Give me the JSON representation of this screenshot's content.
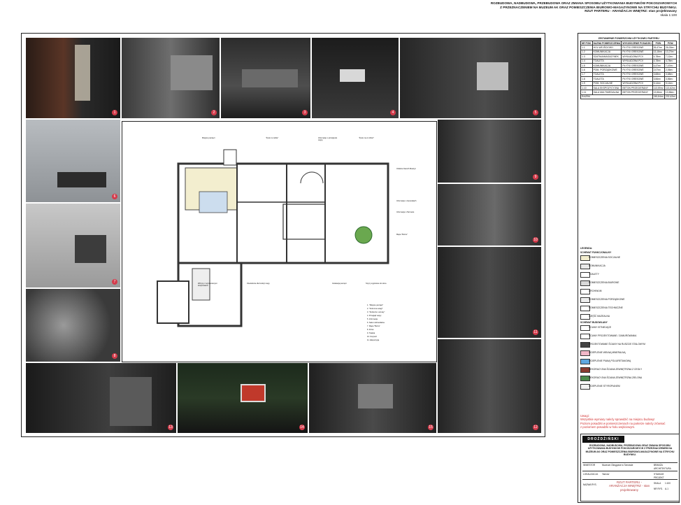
{
  "header": {
    "lines": [
      "ROZBUDOWA, NADBUDOWA, PRZEBUDOWA ORAZ ZMIANA SPOSOBU UŻYTKOWANIA BUDYNKÓW POKOSZAROWYCH",
      "Z PRZEZNACZENIEM NA MUZEUM AK ORAZ POMIESZCZENIA BIUROWO-MAGAZYNOWE NA STRYCHU BUDYNKU.",
      "RZUT PARTERU - ARANŻACJA WNĘTRZ: stan projektowany"
    ],
    "scale": "skala 1:100"
  },
  "photos": [
    {
      "id": "photo-1",
      "num": "1"
    },
    {
      "id": "photo-2",
      "num": "2"
    },
    {
      "id": "photo-3",
      "num": "3"
    },
    {
      "id": "photo-4",
      "num": "4"
    },
    {
      "id": "photo-5",
      "num": "5"
    },
    {
      "id": "photo-6",
      "num": "6"
    },
    {
      "id": "photo-7",
      "num": "7"
    },
    {
      "id": "photo-8",
      "num": "8"
    },
    {
      "id": "photo-9",
      "num": "9"
    },
    {
      "id": "photo-10",
      "num": "10"
    },
    {
      "id": "photo-11",
      "num": "11"
    },
    {
      "id": "photo-12",
      "num": "12"
    },
    {
      "id": "photo-13",
      "num": "13"
    },
    {
      "id": "photo-14",
      "num": "14"
    },
    {
      "id": "photo-15",
      "num": "15"
    },
    {
      "id": "photo-16",
      "num": "16"
    },
    {
      "id": "photo-17",
      "num": "17"
    }
  ],
  "plan": {
    "callouts": [
      "Miejsce pamięci",
      "\"Życie w niebie\"",
      "Informacje o przepływie wojny",
      "\"Życie na co dzień\"",
      "Odsłona Sanich Maszyn",
      "Informacje o Generałach",
      "Informacja o Tarnowie",
      "Mapa \"Burza\"",
      "Witryny z wymienianymi eksponatami",
      "Oświetlenie dla funkcji mapy",
      "Instalacja pamięci",
      "Szyny wyjściowe do okna"
    ],
    "notes": [
      "1. \"Miejsce pamięci\"",
      "2. \"Kolumna uwagi\"",
      "3. \"Żołnierze i armaty\"",
      "4. Przegląd wojny",
      "5. Informacja",
      "6. Sala multimedialna",
      "7. Mapa \"Burza\"",
      "8. Drzwi",
      "9. Toaleta",
      "10. Korytarz",
      "11. Ekspozycja"
    ]
  },
  "table": {
    "title": "ZESTAWIENIE POWIERZCHNI UŻYTKOWEJ PARTERU",
    "headers": [
      "NR POM.",
      "NAZWA POMIESZCZENIA",
      "WYKOŃCZENIE POSADZKI",
      "POW.",
      "POW."
    ],
    "rows": [
      [
        "1.1",
        "HOL WEJŚCIOWY",
        "PŁYTKI GRESOWE",
        "26,47m²",
        "26,00m²"
      ],
      [
        "1.2",
        "KOMUNIKACJA",
        "PŁYTKI GRESOWE",
        "13,18m²",
        "13,27m²"
      ],
      [
        "1.3",
        "SZATNIA/MAGAZYNEK",
        "WYKŁADZINA PCV",
        "4,78m²",
        "7,12m²"
      ],
      [
        "1.4",
        "TOALETA",
        "WYKŁADZINA PCV",
        "4,78m²",
        "4,78m²"
      ],
      [
        "1.5",
        "KOMUNIKACJA",
        "PŁYTKI GRESOWE",
        "4,47m²",
        "7,47m²"
      ],
      [
        "1.6",
        "POM. PORZĄDKOWE",
        "PŁYTKI GRESOWE",
        "2,07m²",
        "2,06m²"
      ],
      [
        "1.7",
        "TOALETA",
        "PŁYTKI GRESOWE",
        "3,68m²",
        "3,68m²"
      ],
      [
        "1.8",
        "TOALETA",
        "PŁYTKI GRESOWE",
        "3,56m²",
        "3,56m²"
      ],
      [
        "1.9",
        "POM. SOCJALNE",
        "WYKŁADZINA PCV",
        "5,14m²",
        "5,14m²"
      ],
      [
        "1.10",
        "SALA EKSPOZYCYJNA",
        "BETON PRZECIERANY",
        "113,59m²",
        "113,62m²"
      ],
      [
        "1.11",
        "SALA MULTIMEDIALNA",
        "BETON PRZECIERANY",
        "13,56m²",
        "13,56m²"
      ]
    ],
    "sum_label": "RAZEM",
    "sum_a": "245,84m²",
    "sum_b": "232,42m²"
  },
  "legend": {
    "title": "LEGENDA:",
    "section1": "SCHEMAT FUNKCJONALNY",
    "items1": [
      {
        "label": "POMIESZCZENIA SOCJALNE",
        "color": "#f3eecf"
      },
      {
        "label": "KOMUNIKACJA",
        "color": "#e8e8e8"
      },
      {
        "label": "TOALETY",
        "color": "#ffffff"
      },
      {
        "label": "POMIESZCZENIA BIUROWE",
        "color": "#d9d9d9"
      },
      {
        "label": "ARCHIWUM",
        "color": "#ffffff"
      },
      {
        "label": "POMIESZCZENIA PORZĄDKOWE",
        "color": "#eeeeee"
      },
      {
        "label": "POMIESZCZENIA TECHNICZNE",
        "color": "#ffffff"
      },
      {
        "label": "CZĘŚĆ MUZEALNA",
        "color": "#ffffff"
      }
    ],
    "section2": "SCHEMAT BUDOWLANY",
    "items2": [
      {
        "label": "ŚCIANY ISTNIEJĄCE",
        "color": "#ffffff"
      },
      {
        "label": "ŚCIANY PROJEKTOWANE / ZAMUROWANIA",
        "color": "#ffffff"
      },
      {
        "label": "PROJEKTOWANE ŚCIANY NA RUSZCIE STALOWYM",
        "color": "#444444"
      },
      {
        "label": "OCIEPLENIE WEŁNĄ MINERALNĄ",
        "color": "#f1b8c8"
      },
      {
        "label": "OCIEPLENIE PIANĄ POLIURETANOWĄ",
        "color": "#5fa8e0"
      },
      {
        "label": "DEKORACYJNA ŚCIANA ZEWNĘTRZNA Z CEGŁY",
        "color": "#8a3b30"
      },
      {
        "label": "DEKORACYJNA ŚCIANA ZEWNĘTRZNA ZIELONA",
        "color": "#4c8a4c"
      },
      {
        "label": "OCIEPLENIE STYROPIANEM",
        "color": "#f2f2f2"
      }
    ]
  },
  "uwagi": {
    "title": "Uwagi:",
    "lines": [
      "Wszystkie wymiary należy sprawdzić na miejscu budowy!",
      "Poziom posadzki w pomieszczeniach na parterze należy zrównać",
      "z poziomem posadzki w holu wejściowym."
    ]
  },
  "titleblock": {
    "logo": "DROŻDŻIŃSKI ARCHITEKT",
    "project": "ROZBUDOWA, NADBUDOWA, PRZEBUDOWA ORAZ ZMIANA SPOSOBU UŻYTKOWANIA BUDYNKÓW POKOSZAROWYCH Z PRZEZNACZENIEM NA MUZEUM AK ORAZ POMIESZCZENIA BIUROWO-MAGAZYNOWE NA STRYCHU BUDYNKU.",
    "sheet_title": "RZUT PARTERU - ARANŻACJA WNĘTRZ - stan projektowany",
    "labels": [
      "INWESTOR",
      "LOKALIZACJA",
      "NAZWA RYS.",
      "BRANŻA",
      "ARCHITEKTURA",
      "STADIUM",
      "SKALA",
      "NR RYS."
    ],
    "values": [
      "Muzeum Okręgowe w Tarnowie",
      "Tarnów",
      "RZUT PARTERU",
      "ARCHITEKTURA",
      "PROJEKT",
      "1:100",
      "A-1"
    ]
  }
}
